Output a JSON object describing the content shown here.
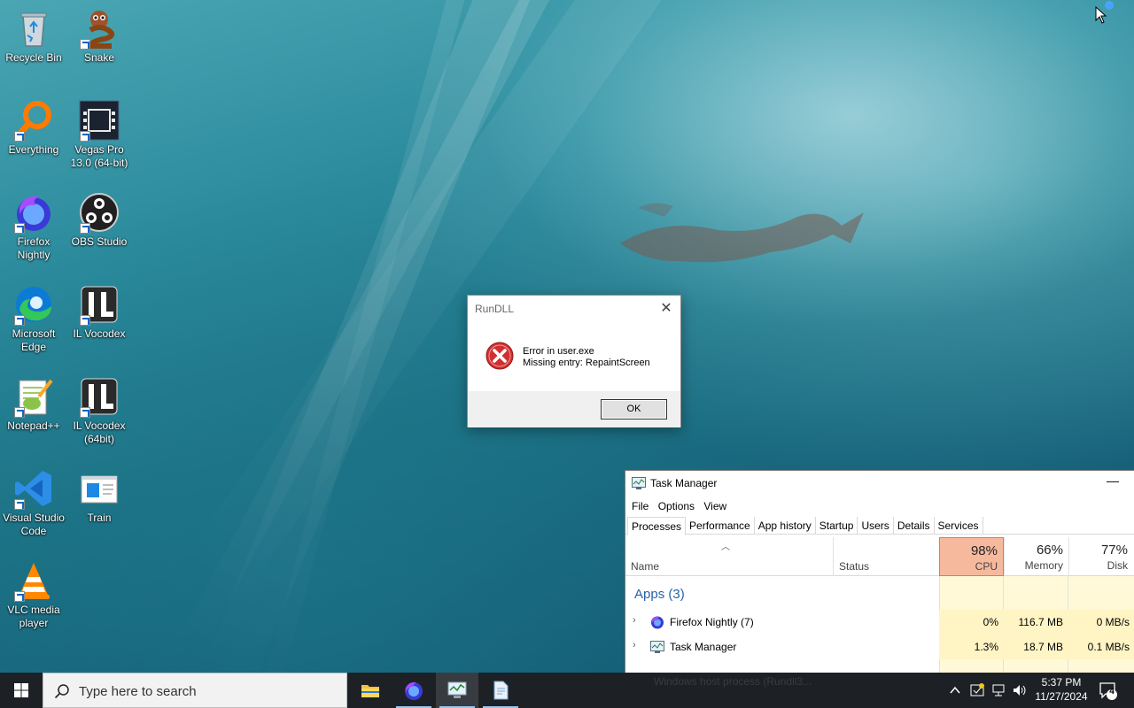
{
  "desktop": {
    "icons": [
      {
        "label": "Recycle Bin",
        "icon": "recycle-bin-icon"
      },
      {
        "label": "Snake",
        "icon": "snake-icon"
      },
      {
        "label": "Everything",
        "icon": "everything-search-icon"
      },
      {
        "label": "Vegas Pro 13.0 (64-bit)",
        "icon": "vegas-pro-icon"
      },
      {
        "label": "Firefox Nightly",
        "icon": "firefox-nightly-icon"
      },
      {
        "label": "OBS Studio",
        "icon": "obs-studio-icon"
      },
      {
        "label": "Microsoft Edge",
        "icon": "microsoft-edge-icon"
      },
      {
        "label": "IL Vocodex",
        "icon": "il-vocodex-icon"
      },
      {
        "label": "Notepad++",
        "icon": "notepad-plus-plus-icon"
      },
      {
        "label": "IL Vocodex (64bit)",
        "icon": "il-vocodex-64-icon"
      },
      {
        "label": "Visual Studio Code",
        "icon": "vscode-icon"
      },
      {
        "label": "Train",
        "icon": "train-icon"
      },
      {
        "label": "VLC media player",
        "icon": "vlc-icon"
      }
    ]
  },
  "dialog": {
    "title": "RunDLL",
    "close_symbol": "✕",
    "message_line1": "Error in user.exe",
    "message_line2": "Missing entry: RepaintScreen",
    "ok_label": "OK",
    "icon": "error-icon"
  },
  "task_manager": {
    "title": "Task Manager",
    "minimize_symbol": "—",
    "menu": [
      "File",
      "Options",
      "View"
    ],
    "tabs": [
      "Processes",
      "Performance",
      "App history",
      "Startup",
      "Users",
      "Details",
      "Services"
    ],
    "active_tab": "Processes",
    "columns": {
      "name": "Name",
      "status": "Status",
      "cpu": {
        "pct": "98%",
        "label": "CPU"
      },
      "memory": {
        "pct": "66%",
        "label": "Memory"
      },
      "disk": {
        "pct": "77%",
        "label": "Disk"
      }
    },
    "group_label": "Apps (3)",
    "rows": [
      {
        "name": "Firefox Nightly (7)",
        "cpu": "0%",
        "memory": "116.7 MB",
        "disk": "0 MB/s",
        "icon": "firefox-nightly-icon"
      },
      {
        "name": "Task Manager",
        "cpu": "1.3%",
        "memory": "18.7 MB",
        "disk": "0.1 MB/s",
        "icon": "task-manager-icon"
      }
    ],
    "partial_row": "Windows host process (Rundll3..."
  },
  "taskbar": {
    "search_placeholder": "Type here to search",
    "apps": [
      "file-explorer-icon",
      "firefox-nightly-icon",
      "task-manager-icon",
      "notepad-icon"
    ],
    "clock_time": "5:37 PM",
    "clock_date": "11/27/2024",
    "notification_count": "4"
  },
  "colors": {
    "cpu_header_bg": "#f7b99d",
    "usage_cell_bg": "#fff4c4",
    "group_label": "#2862a8",
    "taskbar_bg": "#0a0e14"
  }
}
